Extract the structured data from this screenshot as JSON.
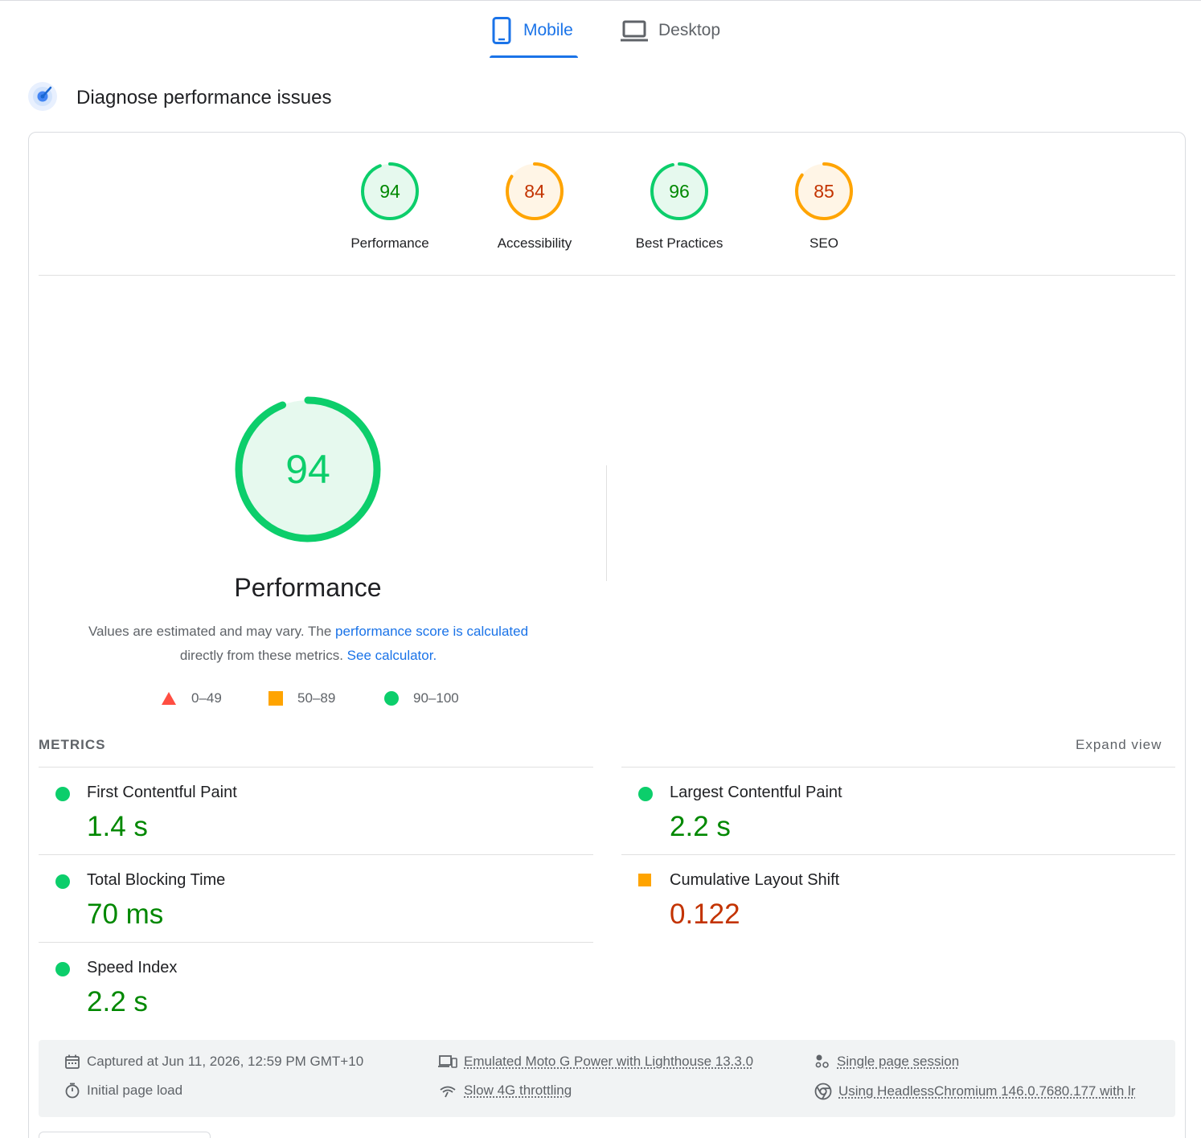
{
  "tabs": [
    {
      "label": "Mobile",
      "icon": "smartphone-icon",
      "active": true
    },
    {
      "label": "Desktop",
      "icon": "laptop-icon",
      "active": false
    }
  ],
  "section": {
    "title": "Diagnose performance issues",
    "icon": "lighthouse-icon"
  },
  "categories": [
    {
      "score": 94,
      "label": "Performance",
      "rating": "pass"
    },
    {
      "score": 84,
      "label": "Accessibility",
      "rating": "average"
    },
    {
      "score": 96,
      "label": "Best Practices",
      "rating": "pass"
    },
    {
      "score": 85,
      "label": "SEO",
      "rating": "average"
    }
  ],
  "performance": {
    "score": 94,
    "title": "Performance",
    "desc_prefix": "Values are estimated and may vary. The ",
    "desc_link1": "performance score is calculated",
    "desc_middle": "directly from these metrics.",
    "desc_link2": "See calculator."
  },
  "legend": [
    {
      "shape": "triangle",
      "label": "0–49"
    },
    {
      "shape": "square",
      "label": "50–89"
    },
    {
      "shape": "circle",
      "label": "90–100"
    }
  ],
  "metrics": {
    "heading": "METRICS",
    "expand_label": "Expand view",
    "items": [
      {
        "name": "First Contentful Paint",
        "value": "1.4 s",
        "rating": "pass"
      },
      {
        "name": "Largest Contentful Paint",
        "value": "2.2 s",
        "rating": "pass"
      },
      {
        "name": "Total Blocking Time",
        "value": "70 ms",
        "rating": "pass"
      },
      {
        "name": "Cumulative Layout Shift",
        "value": "0.122",
        "rating": "average"
      },
      {
        "name": "Speed Index",
        "value": "2.2 s",
        "rating": "pass"
      }
    ]
  },
  "footer": {
    "captured": "Captured at Jun 11, 2026, 12:59 PM GMT+10",
    "load": "Initial page load",
    "device": "Emulated Moto G Power with Lighthouse 13.3.0",
    "throttling": "Slow 4G throttling",
    "session": "Single page session",
    "browser": "Using HeadlessChromium 146.0.7680.177 with lr"
  },
  "colors": {
    "pass": "#0cce6b",
    "average": "#ffa400",
    "fail": "#ff4e42",
    "pass_text": "#008800",
    "average_text": "#c33300",
    "accent": "#1a73e8"
  }
}
